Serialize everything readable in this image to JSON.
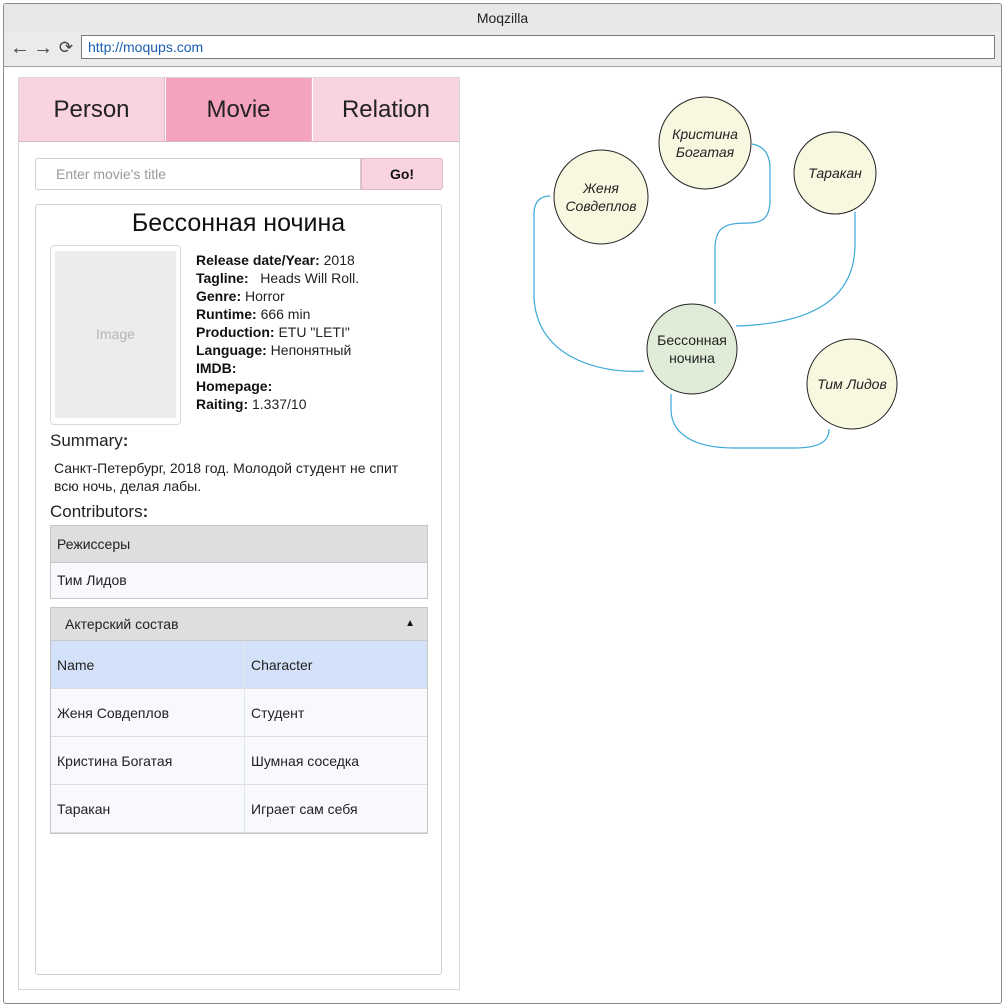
{
  "window": {
    "title": "Moqzilla",
    "url": "http://moqups.com"
  },
  "nav": {
    "back_icon": "←",
    "forward_icon": "→",
    "reload_icon": "⟳"
  },
  "tabs": [
    {
      "label": "Person"
    },
    {
      "label": "Movie"
    },
    {
      "label": "Relation"
    }
  ],
  "search": {
    "placeholder": "Enter movie's title",
    "button_label": "Go!"
  },
  "movie": {
    "title": "Бессонная ночина",
    "poster_placeholder": "Image",
    "fields": [
      {
        "label": "Release date/Year:",
        "value": "2018"
      },
      {
        "label": "Tagline:",
        "value": "  Heads Will Roll."
      },
      {
        "label": "Genre:",
        "value": "Horror"
      },
      {
        "label": "Runtime:",
        "value": "666 min"
      },
      {
        "label": "Production:",
        "value": "ETU \"LETI\""
      },
      {
        "label": "Language:",
        "value": "Непонятный"
      },
      {
        "label": "IMDB:",
        "value": ""
      },
      {
        "label": "Homepage:",
        "value": ""
      },
      {
        "label": "Raiting:",
        "value": "1.337/10"
      }
    ],
    "summary_label": "Summary",
    "summary_colon": ":",
    "summary_text": "Санкт-Петербург, 2018 год. Молодой студент не спит всю ночь, делая лабы.",
    "contributors_label": "Contributors",
    "contributors_colon": ":"
  },
  "directors": {
    "header": "Режиссеры",
    "items": [
      "Тим Лидов"
    ]
  },
  "cast": {
    "header": "Актерский состав",
    "caret": "▲",
    "columns": [
      "Name",
      "Character"
    ],
    "rows": [
      [
        "Женя Совдеплов",
        "Студент"
      ],
      [
        "Кристина Богатая",
        "Шумная соседка"
      ],
      [
        "Таракан",
        "Играет сам себя"
      ]
    ]
  },
  "graph": {
    "center": {
      "lines": [
        "Бессонная",
        "ночина"
      ],
      "fill": "#e0ecd8"
    },
    "nodes": [
      {
        "id": "zhenya",
        "lines": [
          "Женя",
          "Совдеплов"
        ]
      },
      {
        "id": "kristina",
        "lines": [
          "Кристина",
          "Богатая"
        ]
      },
      {
        "id": "tarakan",
        "lines": [
          "Таракан"
        ]
      },
      {
        "id": "tim",
        "lines": [
          "Тим Лидов"
        ]
      }
    ],
    "node_fill": "#f7f8df",
    "edge_color": "#3aa8d8"
  }
}
